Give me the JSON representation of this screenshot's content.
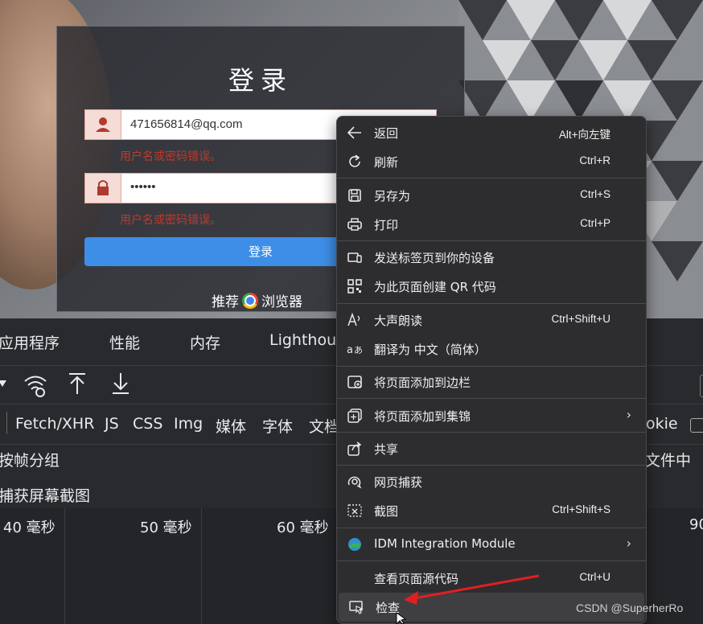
{
  "login": {
    "title": "登录",
    "username_value": "471656814@qq.com",
    "password_value": "••••••",
    "error1": "用户名或密码错误。",
    "error2": "用户名或密码错误。",
    "submit_label": "登录",
    "recommend_prefix": "推荐",
    "recommend_suffix": "浏览器"
  },
  "devtools": {
    "tabs": [
      "应用程序",
      "性能",
      "内存",
      "Lighthous"
    ],
    "filters": [
      "Fetch/XHR",
      "JS",
      "CSS",
      "Img",
      "媒体",
      "字体",
      "文档"
    ],
    "filter_right": "okie",
    "option1": "按帧分组",
    "option2": "捕获屏幕截图",
    "option_right": "文件中",
    "ticks": [
      "40 毫秒",
      "50 毫秒",
      "60 毫秒",
      "90"
    ]
  },
  "menu": {
    "items": [
      {
        "label": "返回",
        "shortcut": "Alt+向左键",
        "icon": "back-arrow-icon"
      },
      {
        "label": "刷新",
        "shortcut": "Ctrl+R",
        "icon": "refresh-icon"
      },
      {
        "label": "另存为",
        "shortcut": "Ctrl+S",
        "icon": "save-icon"
      },
      {
        "label": "打印",
        "shortcut": "Ctrl+P",
        "icon": "print-icon"
      },
      {
        "label": "发送标签页到你的设备",
        "shortcut": "",
        "icon": "send-device-icon"
      },
      {
        "label": "为此页面创建 QR 代码",
        "shortcut": "",
        "icon": "qr-code-icon"
      },
      {
        "label": "大声朗读",
        "shortcut": "Ctrl+Shift+U",
        "icon": "read-aloud-icon"
      },
      {
        "label": "翻译为 中文（简体）",
        "shortcut": "",
        "icon": "translate-icon"
      },
      {
        "label": "将页面添加到边栏",
        "shortcut": "",
        "icon": "add-sidebar-icon"
      },
      {
        "label": "将页面添加到集锦",
        "shortcut": "",
        "icon": "collections-icon"
      },
      {
        "label": "共享",
        "shortcut": "",
        "icon": "share-icon"
      },
      {
        "label": "网页捕获",
        "shortcut": "",
        "icon": "web-capture-icon"
      },
      {
        "label": "截图",
        "shortcut": "Ctrl+Shift+S",
        "icon": "screenshot-icon"
      },
      {
        "label": "IDM Integration Module",
        "shortcut": "",
        "icon": "idm-icon"
      },
      {
        "label": "查看页面源代码",
        "shortcut": "Ctrl+U",
        "icon": ""
      },
      {
        "label": "检查",
        "shortcut": "",
        "icon": "inspect-icon"
      }
    ]
  },
  "watermark": "CSDN @SuperherRo",
  "colors": {
    "menu_bg": "#2d2d2f",
    "devtools_bg": "#292a2d",
    "button_blue": "#3d8ee6",
    "error_red": "#c0392b",
    "annotation_red": "#e02020"
  }
}
